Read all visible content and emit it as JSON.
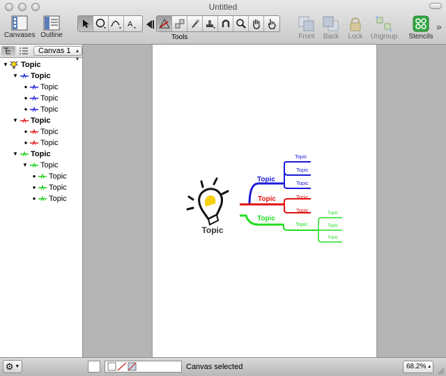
{
  "window": {
    "title": "Untitled"
  },
  "toolbar": {
    "canvases_label": "Canvases",
    "outline_label": "Outline",
    "tools_label": "Tools",
    "front_label": "Front",
    "back_label": "Back",
    "lock_label": "Lock",
    "ungroup_label": "Ungroup",
    "stencils_label": "Stencils",
    "overflow": "»",
    "accent_color": "#2e9e3c"
  },
  "sidebar": {
    "canvas_selector": "Canvas 1",
    "outline": [
      {
        "label": "Topic",
        "bold": true,
        "color": "#555555"
      },
      {
        "label": "Topic",
        "bold": true,
        "color": "#2020e0"
      },
      {
        "label": "Topic",
        "bold": false,
        "color": "#2020e0"
      },
      {
        "label": "Topic",
        "bold": false,
        "color": "#2020e0"
      },
      {
        "label": "Topic",
        "bold": false,
        "color": "#2020e0"
      },
      {
        "label": "Topic",
        "bold": true,
        "color": "#e01818"
      },
      {
        "label": "Topic",
        "bold": false,
        "color": "#e01818"
      },
      {
        "label": "Topic",
        "bold": false,
        "color": "#e01818"
      },
      {
        "label": "Topic",
        "bold": true,
        "color": "#18d018"
      },
      {
        "label": "Topic",
        "bold": false,
        "color": "#18d018"
      },
      {
        "label": "Topic",
        "bold": false,
        "color": "#18d018"
      },
      {
        "label": "Topic",
        "bold": false,
        "color": "#18d018"
      },
      {
        "label": "Topic",
        "bold": false,
        "color": "#18d018"
      }
    ]
  },
  "mindmap": {
    "central": "Topic",
    "blue": {
      "main": "Topic",
      "subs": [
        "Topic",
        "Topic",
        "Topic"
      ],
      "color": "#1a1ad8"
    },
    "red": {
      "main": "Topic",
      "subs": [
        "Topic",
        "Topic"
      ],
      "color": "#e01010"
    },
    "green": {
      "main": "Topic",
      "sub": "Topic",
      "subsubs": [
        "Topic",
        "Topic",
        "Topic"
      ],
      "color": "#22dd22"
    }
  },
  "status": {
    "text": "Canvas selected",
    "zoom": "68.2%"
  }
}
